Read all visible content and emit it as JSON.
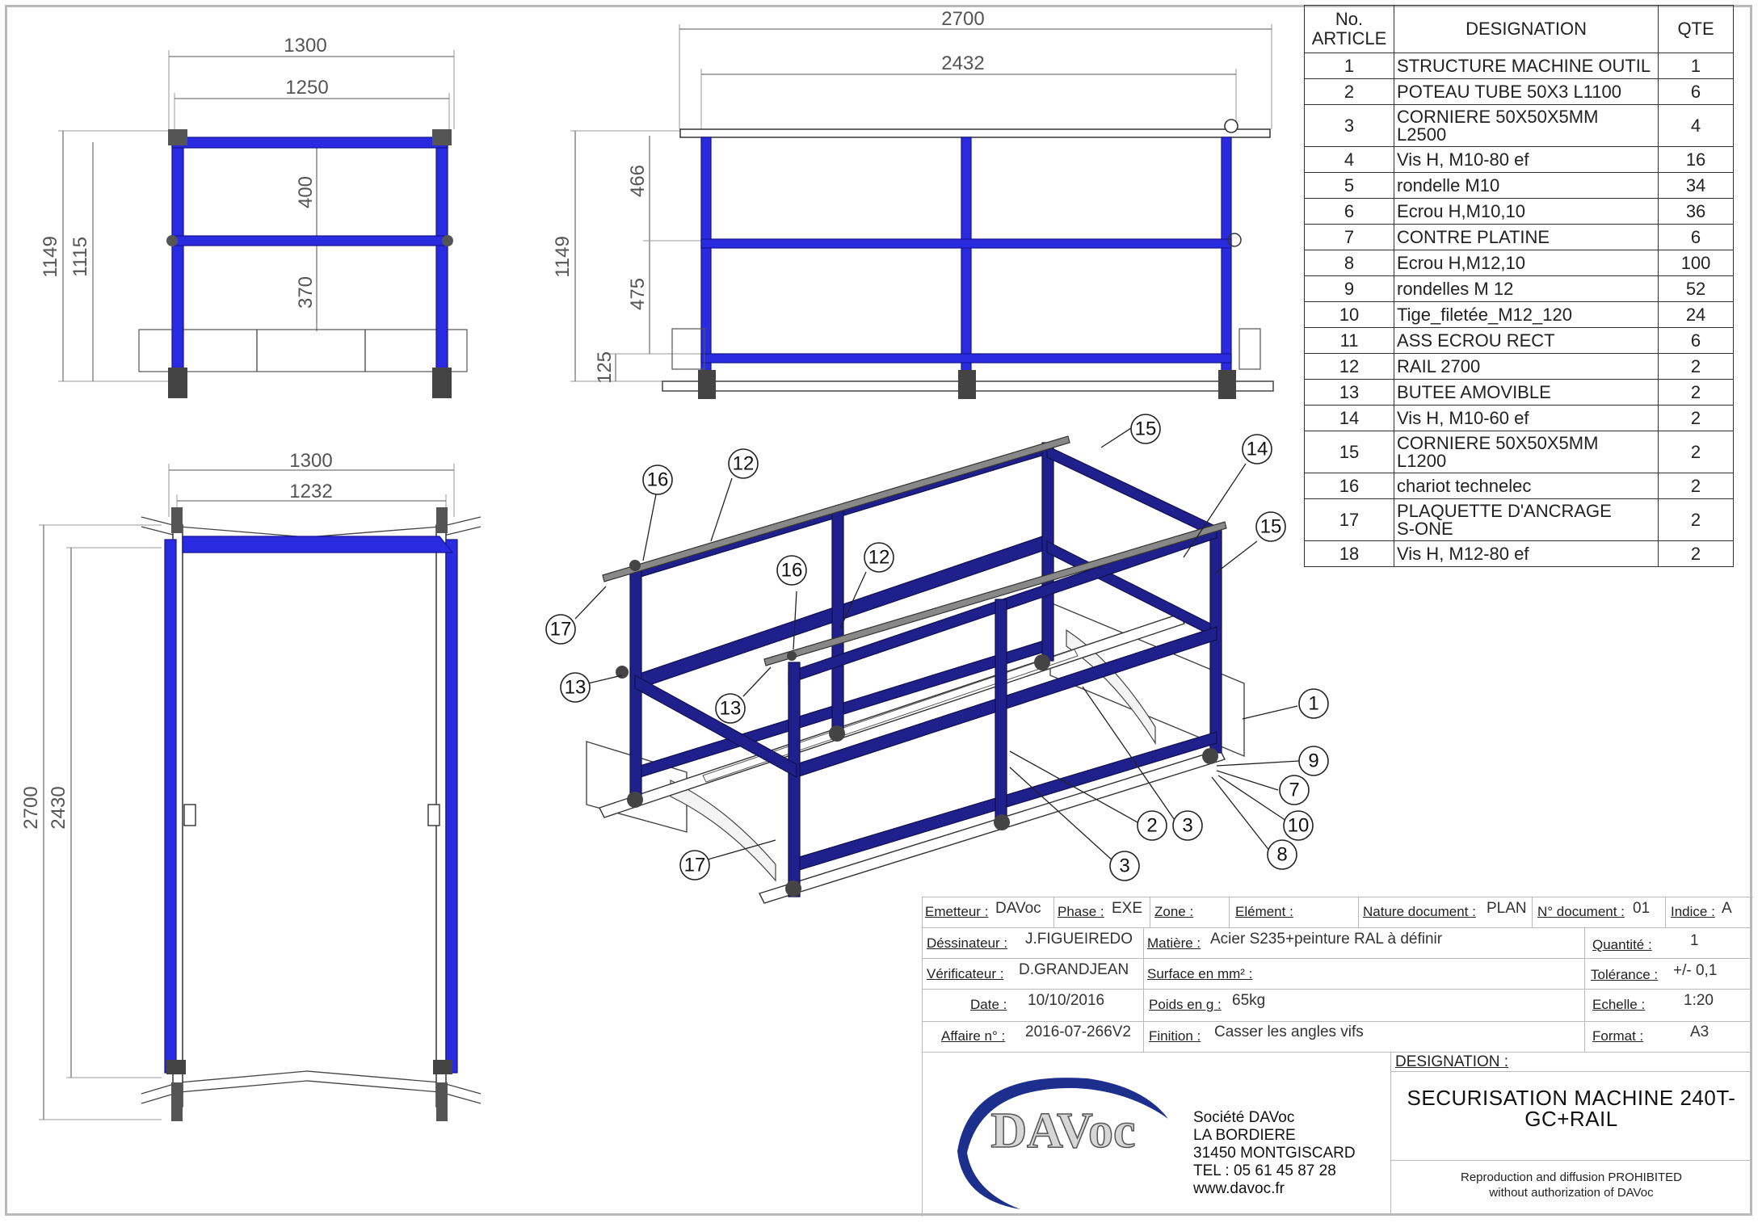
{
  "dimensions": {
    "front_width_outer": "1300",
    "front_width_inner": "1250",
    "front_height_outer": "1149",
    "front_height_inner": "1115",
    "front_upper_gap": "400",
    "front_lower_gap": "370",
    "side_length_outer": "2700",
    "side_length_inner": "2432",
    "side_height": "1149",
    "side_upper_gap": "466",
    "side_lower_gap": "475",
    "side_base": "125",
    "top_width_outer": "1300",
    "top_width_inner": "1232",
    "top_length_outer": "2700",
    "top_length_inner": "2430"
  },
  "balloons": [
    "15",
    "14",
    "16",
    "12",
    "15",
    "16",
    "12",
    "13",
    "17",
    "13",
    "1",
    "9",
    "7",
    "2",
    "3",
    "10",
    "8",
    "3",
    "17"
  ],
  "bom": {
    "headers": {
      "article": "No.\nARTICLE",
      "designation": "DESIGNATION",
      "qte": "QTE"
    },
    "rows": [
      {
        "no": "1",
        "designation": "STRUCTURE MACHINE OUTIL",
        "qte": "1"
      },
      {
        "no": "2",
        "designation": "POTEAU TUBE 50X3 L1100",
        "qte": "6"
      },
      {
        "no": "3",
        "designation": "CORNIERE 50X50X5MM\nL2500",
        "qte": "4"
      },
      {
        "no": "4",
        "designation": "Vis H, M10-80 ef",
        "qte": "16"
      },
      {
        "no": "5",
        "designation": "rondelle M10",
        "qte": "34"
      },
      {
        "no": "6",
        "designation": "Ecrou H,M10,10",
        "qte": "36"
      },
      {
        "no": "7",
        "designation": "CONTRE PLATINE",
        "qte": "6"
      },
      {
        "no": "8",
        "designation": "Ecrou H,M12,10",
        "qte": "100"
      },
      {
        "no": "9",
        "designation": "rondelles M 12",
        "qte": "52"
      },
      {
        "no": "10",
        "designation": "Tige_filetée_M12_120",
        "qte": "24"
      },
      {
        "no": "11",
        "designation": "ASS ECROU RECT",
        "qte": "6"
      },
      {
        "no": "12",
        "designation": "RAIL 2700",
        "qte": "2"
      },
      {
        "no": "13",
        "designation": "BUTEE AMOVIBLE",
        "qte": "2"
      },
      {
        "no": "14",
        "designation": "Vis H, M10-60 ef",
        "qte": "2"
      },
      {
        "no": "15",
        "designation": "CORNIERE 50X50X5MM\nL1200",
        "qte": "2"
      },
      {
        "no": "16",
        "designation": "chariot technelec",
        "qte": "2"
      },
      {
        "no": "17",
        "designation": "PLAQUETTE D'ANCRAGE\nS-ONE",
        "qte": "2"
      },
      {
        "no": "18",
        "designation": "Vis H, M12-80 ef",
        "qte": "2"
      }
    ]
  },
  "title_block": {
    "emetteur_label": "Emetteur :",
    "emetteur": "DAVoc",
    "phase_label": "Phase :",
    "phase": "EXE",
    "zone_label": "Zone :",
    "zone": "",
    "element_label": "Elément :",
    "element": "",
    "nature_label": "Nature document :",
    "nature": "PLAN",
    "ndoc_label": "N° document :",
    "ndoc": "01",
    "indice_label": "Indice :",
    "indice": "A",
    "dessinateur_label": "Déssinateur :",
    "dessinateur": "J.FIGUEIREDO",
    "verificateur_label": "Vérificateur :",
    "verificateur": "D.GRANDJEAN",
    "date_label": "Date :",
    "date": "10/10/2016",
    "affaire_label": "Affaire n° :",
    "affaire": "2016-07-266V2",
    "matiere_label": "Matière :",
    "matiere": "Acier S235+peinture RAL à définir",
    "surface_label": "Surface en mm² :",
    "surface": "",
    "poids_label": "Poids en g :",
    "poids": "65kg",
    "finition_label": "Finition :",
    "finition": "Casser les angles vifs",
    "quantite_label": "Quantité :",
    "quantite": "1",
    "tolerance_label": "Tolérance :",
    "tolerance": "+/- 0,1",
    "echelle_label": "Echelle :",
    "echelle": "1:20",
    "format_label": "Format :",
    "format": "A3",
    "designation_label": "DESIGNATION :",
    "designation": "SECURISATION MACHINE 240T-\nGC+RAIL",
    "logo_text": "DAVoc",
    "company": [
      "Société DAVoc",
      "LA BORDIERE",
      "31450 MONTGISCARD",
      "TEL : 05 61 45 87 28",
      "www.davoc.fr"
    ],
    "copyright": "Reproduction and diffusion PROHIBITED\nwithout authorization of DAVoc"
  },
  "colors": {
    "frame_blue": "#2a2ae0",
    "frame_navy": "#20208c",
    "border": "#b9b9b9",
    "logo_blue": "#1c2f8c"
  }
}
